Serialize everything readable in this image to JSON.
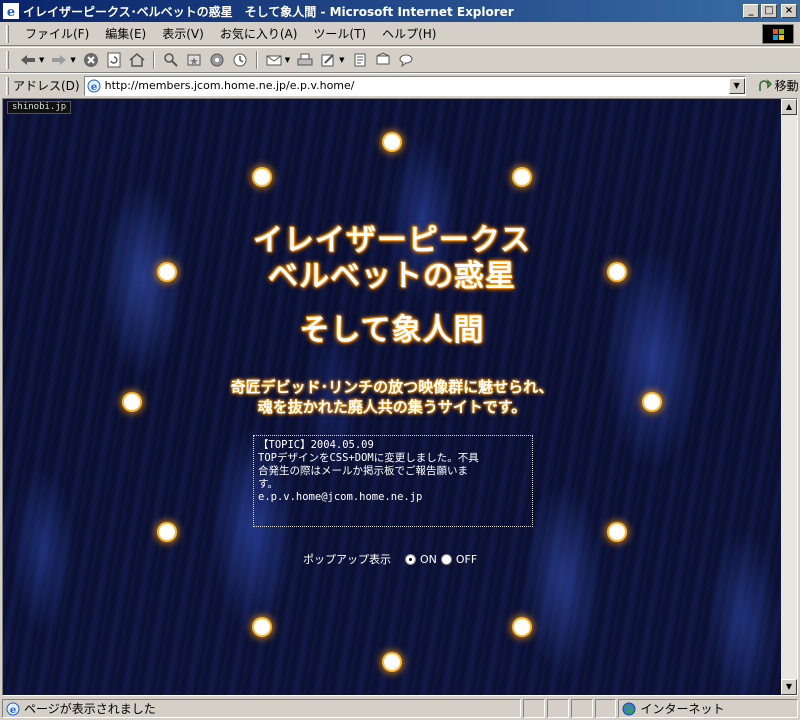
{
  "window": {
    "title": "イレイザーピークス･ベルベットの惑星　そして象人間 - Microsoft Internet Explorer",
    "min_label": "_",
    "max_label": "□",
    "close_label": "×"
  },
  "menu": {
    "items": [
      {
        "label": "ファイル(F)"
      },
      {
        "label": "編集(E)"
      },
      {
        "label": "表示(V)"
      },
      {
        "label": "お気に入り(A)"
      },
      {
        "label": "ツール(T)"
      },
      {
        "label": "ヘルプ(H)"
      }
    ]
  },
  "toolbar": {
    "icons": [
      "back-icon",
      "forward-icon",
      "stop-icon",
      "refresh-icon",
      "home-icon",
      "search-icon",
      "favorites-icon",
      "media-icon",
      "history-icon",
      "mail-icon",
      "print-icon",
      "edit-icon",
      "discuss-icon",
      "messenger-icon"
    ]
  },
  "address": {
    "label": "アドレス(D)",
    "url": "http://members.jcom.home.ne.jp/e.p.v.home/",
    "go_label": "移動"
  },
  "page": {
    "tag": "shinobi.jp",
    "title_line1": "イレイザーピークス",
    "title_line2": "ベルベットの惑星",
    "title_line3": "そして象人間",
    "tagline_line1": "奇匠デビッド･リンチの放つ映像群に魅せられ、",
    "tagline_line2": "魂を抜かれた廃人共の集うサイトです。",
    "topic_line1": "【TOPIC】2004.05.09",
    "topic_line2": "TOPデザインをCSS+DOMに変更しました。不具",
    "topic_line3": "合発生の際はメールか掲示板でご報告願いま",
    "topic_line4": "す。",
    "topic_line5": "e.p.v.home@jcom.home.ne.jp",
    "popup_label": "ポップアップ表示",
    "popup_on": "ON",
    "popup_off": "OFF",
    "accent_color": "#ff9c00"
  },
  "status": {
    "text": "ページが表示されました",
    "zone": "インターネット"
  }
}
